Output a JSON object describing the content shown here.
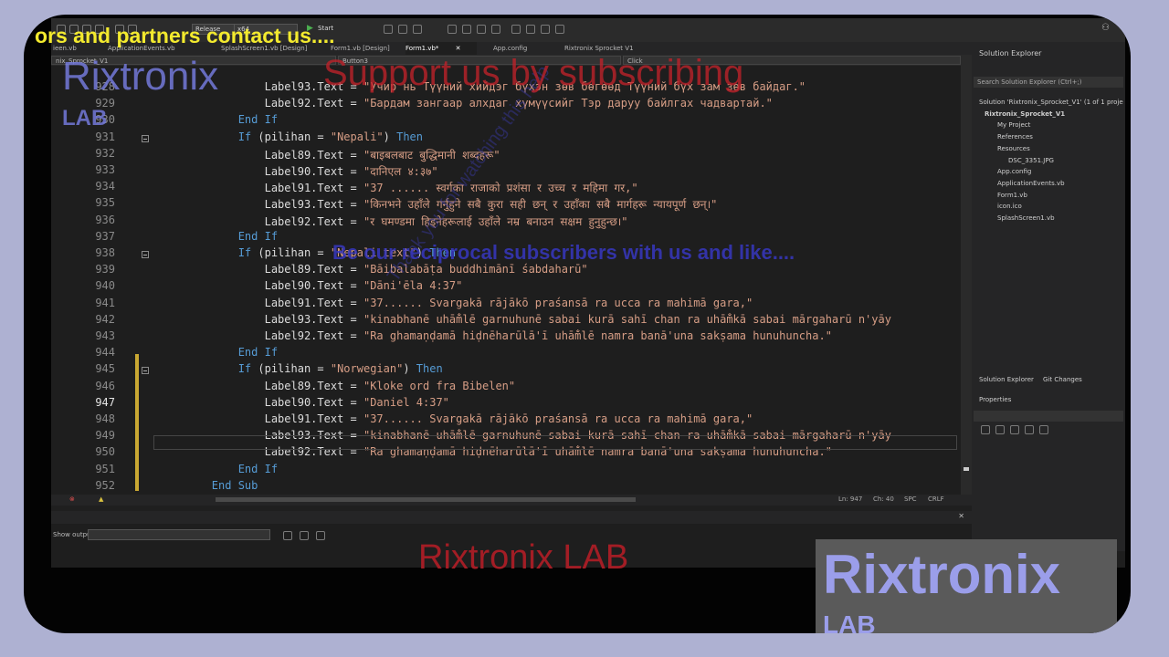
{
  "overlays": {
    "marquee": "ors and partners contact us....",
    "logo_top": "Rixtronix",
    "logo_top_sub": "LAB",
    "support": "Support us by subscribing",
    "reciprocal": "Be our reciprocal subscribers with us and like....",
    "watermark": "Thank you for watching this help",
    "bottom_logo": "Rixtronix LAB",
    "corner_logo": "Rixtronix",
    "corner_logo_sub": "LAB"
  },
  "toolbar": {
    "config_combo": "Release",
    "platform_combo": "x64",
    "start_label": "Start"
  },
  "tabs": [
    {
      "label": "ieen.vb"
    },
    {
      "label": "ApplicationEvents.vb"
    },
    {
      "label": "SplashScreen1.vb [Design]"
    },
    {
      "label": "Form1.vb [Design]"
    },
    {
      "label": "Form1.vb*"
    },
    {
      "label": "App.config"
    },
    {
      "label": "Rixtronix Sprocket V1"
    }
  ],
  "navbar": {
    "project": "nix_Sprocket_V1",
    "object": "Button3",
    "event": "Click"
  },
  "editor": {
    "lines": [
      {
        "n": "928",
        "t": "                Label93.Text = \"Учир нь Түүний хийдэг бүхэн зөв бөгөөд Түүний бүх зам зөв байдаг.\""
      },
      {
        "n": "929",
        "t": "                Label92.Text = \"Бардам зангаар алхдаг хүмүүсийг Тэр даруу байлгах чадвартай.\""
      },
      {
        "n": "930",
        "t": "            End If"
      },
      {
        "n": "931",
        "t": "            If (pilihan = \"Nepali\") Then"
      },
      {
        "n": "932",
        "t": "                Label89.Text = \"बाइबलबाट बुद्धिमानी शब्दहरू\""
      },
      {
        "n": "933",
        "t": "                Label90.Text = \"दानिएल ४:३७\""
      },
      {
        "n": "934",
        "t": "                Label91.Text = \"37 ...... स्वर्गका राजाको प्रशंसा र उच्च र महिमा गर,\""
      },
      {
        "n": "935",
        "t": "                Label93.Text = \"किनभने उहाँले गर्नुहुने सबै कुरा सही छन् र उहाँका सबै मार्गहरू न्यायपूर्ण छन्।\""
      },
      {
        "n": "936",
        "t": "                Label92.Text = \"र घमण्डमा हिड्नेहरूलाई उहाँले नम्र बनाउन सक्षम हुनुहुन्छ।\""
      },
      {
        "n": "937",
        "t": "            End If"
      },
      {
        "n": "938",
        "t": "            If (pilihan = \"Nepali text\") Then"
      },
      {
        "n": "939",
        "t": "                Label89.Text = \"Bāibalabāṭa buddhimānī śabdaharū\""
      },
      {
        "n": "940",
        "t": "                Label90.Text = \"Dāni'ēla 4:37\""
      },
      {
        "n": "941",
        "t": "                Label91.Text = \"37...... Svargakā rājākō praśansā ra ucca ra mahimā gara,\""
      },
      {
        "n": "942",
        "t": "                Label93.Text = \"kinabhanē uhām̐lē garnuhunē sabai kurā sahī chan ra uhām̐kā sabai mārgaharū n'yāy"
      },
      {
        "n": "943",
        "t": "                Label92.Text = \"Ra ghamaṇḍamā hiḍnēharūlā'ī uhām̐lē namra banā'una sakṣama hunuhuncha.\""
      },
      {
        "n": "944",
        "t": "            End If"
      },
      {
        "n": "945",
        "t": "            If (pilihan = \"Norwegian\") Then"
      },
      {
        "n": "946",
        "t": "                Label89.Text = \"Kloke ord fra Bibelen\""
      },
      {
        "n": "947",
        "t": "                Label90.Text = \"Daniel 4:37\""
      },
      {
        "n": "948",
        "t": "                Label91.Text = \"37...... Svargakā rājākō praśansā ra ucca ra mahimā gara,\""
      },
      {
        "n": "949",
        "t": "                Label93.Text = \"kinabhanē uhām̐lē garnuhunē sabai kurā sahī chan ra uhām̐kā sabai mārgaharū n'yāy"
      },
      {
        "n": "950",
        "t": "                Label92.Text = \"Ra ghamaṇḍamā hiḍnēharūlā'ī uhām̐lē namra banā'una sakṣama hunuhuncha.\""
      },
      {
        "n": "951",
        "t": "            End If"
      },
      {
        "n": "952",
        "t": "        End Sub"
      }
    ]
  },
  "status": {
    "line": "Ln: 947",
    "ch": "Ch: 40",
    "spc": "SPC",
    "crlf": "CRLF"
  },
  "output": {
    "show_from": "Show output from:"
  },
  "solution": {
    "title": "Solution Explorer",
    "search": "Search Solution Explorer (Ctrl+;)",
    "items": [
      "Solution 'Rixtronix_Sprocket_V1' (1 of 1 proje",
      "Rixtronix_Sprocket_V1",
      "My Project",
      "References",
      "Resources",
      "DSC_3351.JPG",
      "App.config",
      "ApplicationEvents.vb",
      "Form1.vb",
      "icon.ico",
      "SplashScreen1.vb"
    ],
    "tab1": "Solution Explorer",
    "tab2": "Git Changes",
    "properties": "Properties"
  }
}
